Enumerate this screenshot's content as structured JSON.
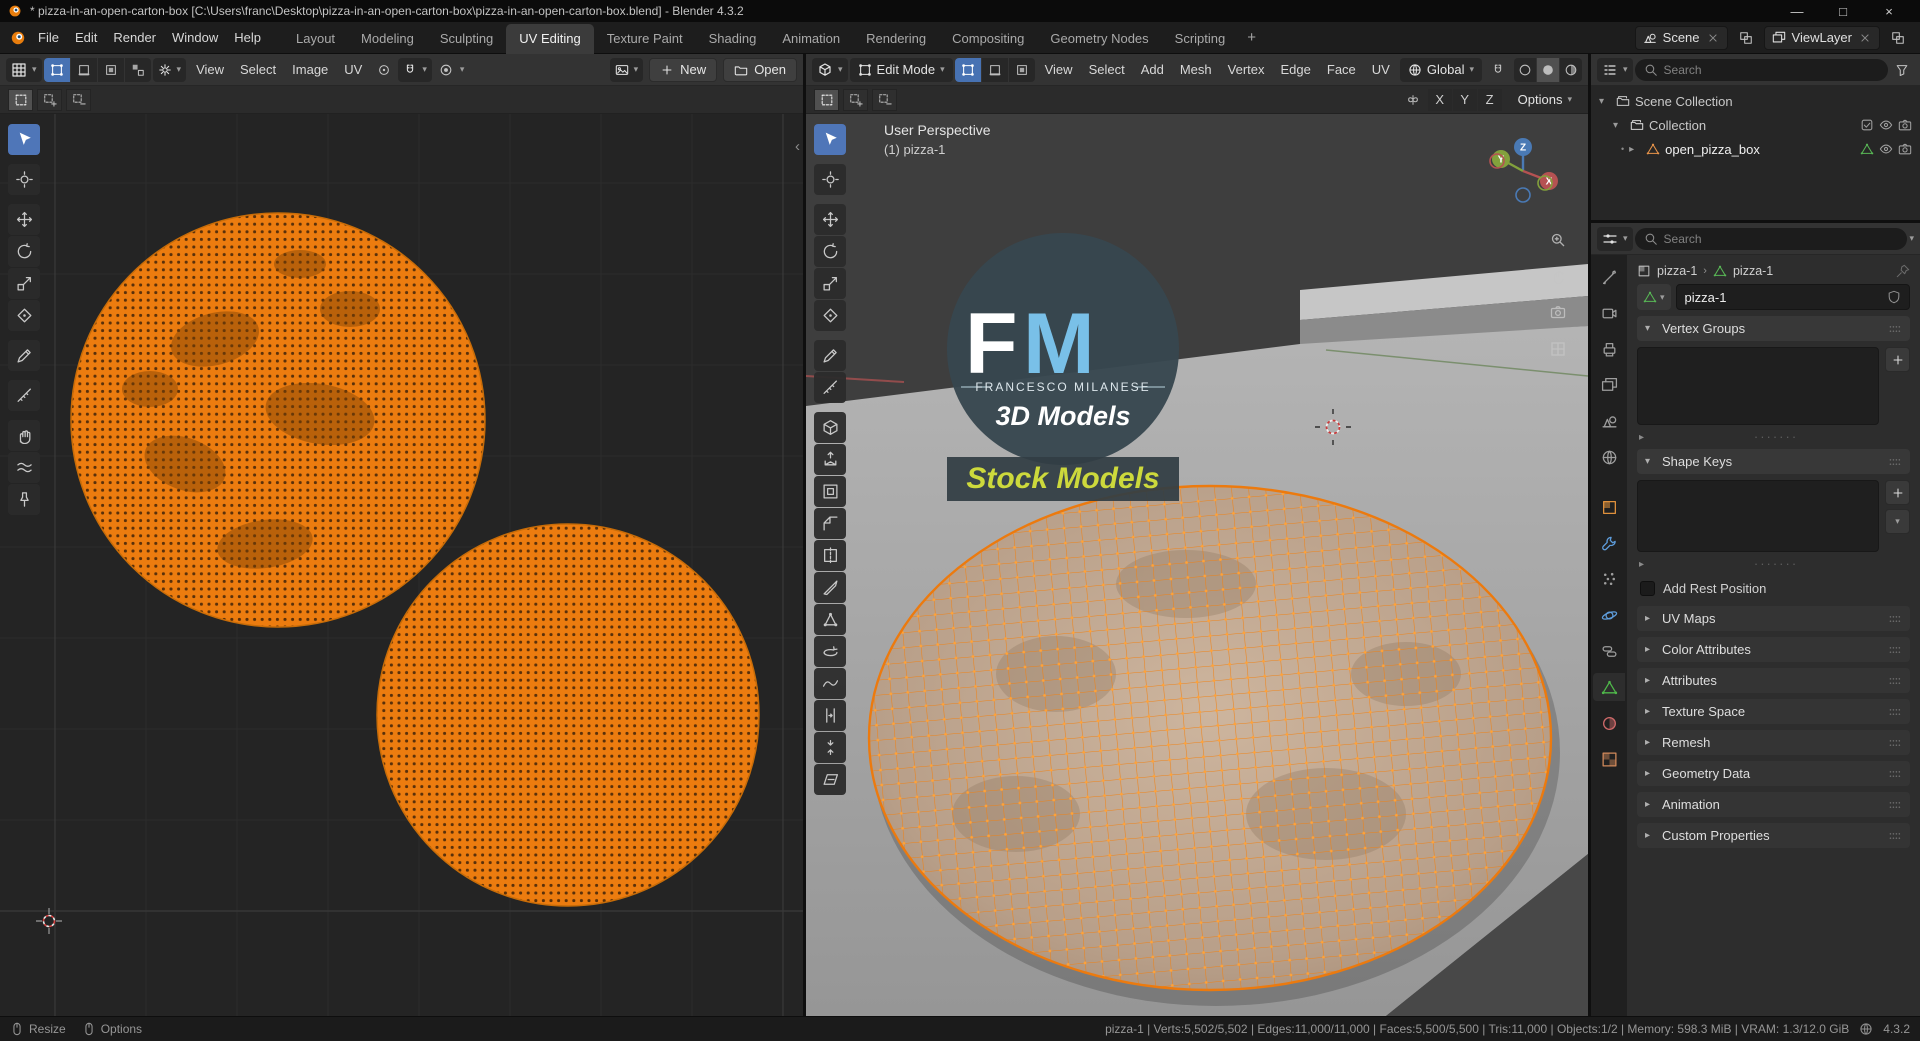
{
  "window": {
    "title": "* pizza-in-an-open-carton-box [C:\\Users\\franc\\Desktop\\pizza-in-an-open-carton-box\\pizza-in-an-open-carton-box.blend] - Blender 4.3.2",
    "minimize": "—",
    "maximize": "□",
    "close": "×"
  },
  "glyphs": {
    "expanded": "▾",
    "collapsed": "▸",
    "chevron": "▾",
    "bc_sep": "›",
    "region_collapse": "‹",
    "bullet": "•",
    "dots": "·······",
    "plus": "+",
    "minus": "−"
  },
  "topbar": {
    "menus": [
      "File",
      "Edit",
      "Render",
      "Window",
      "Help"
    ],
    "workspaces": [
      {
        "label": "Layout"
      },
      {
        "label": "Modeling"
      },
      {
        "label": "Sculpting"
      },
      {
        "label": "UV Editing",
        "active": true
      },
      {
        "label": "Texture Paint"
      },
      {
        "label": "Shading"
      },
      {
        "label": "Animation"
      },
      {
        "label": "Rendering"
      },
      {
        "label": "Compositing"
      },
      {
        "label": "Geometry Nodes"
      },
      {
        "label": "Scripting"
      }
    ],
    "add_workspace": "+",
    "scene": "Scene",
    "view_layer": "ViewLayer"
  },
  "uv_editor": {
    "menus": [
      "View",
      "Select",
      "Image",
      "UV"
    ],
    "new_button": "New",
    "open_button": "Open",
    "tools": [
      {
        "name": "select-box",
        "icon": "select",
        "active": true
      },
      {
        "name": "cursor",
        "icon": "cursor",
        "gap": true
      },
      {
        "name": "move",
        "icon": "move",
        "gap": true
      },
      {
        "name": "rotate",
        "icon": "rotate"
      },
      {
        "name": "scale",
        "icon": "scale"
      },
      {
        "name": "transform",
        "icon": "transform"
      },
      {
        "name": "annotate",
        "icon": "annotate",
        "gap": true
      },
      {
        "name": "measure",
        "icon": "measure",
        "gap": true
      },
      {
        "name": "grab",
        "icon": "grab",
        "gap": true
      },
      {
        "name": "relax",
        "icon": "relax"
      },
      {
        "name": "pin",
        "icon": "pin"
      }
    ]
  },
  "viewport": {
    "mode": "Edit Mode",
    "menus": [
      "View",
      "Select",
      "Add",
      "Mesh",
      "Vertex",
      "Edge",
      "Face",
      "UV"
    ],
    "orientation": "Global",
    "mirror": [
      "X",
      "Y",
      "Z"
    ],
    "options_label": "Options",
    "overlay_perspective": "User Perspective",
    "overlay_object": "(1) pizza-1",
    "axis_x": "X",
    "axis_y": "Y",
    "axis_z": "Z",
    "logo": {
      "f": "F",
      "m": "M",
      "name": "FRANCESCO MILANESE",
      "tagline": "3D Models",
      "badge": "Stock Models"
    },
    "tools": [
      {
        "name": "select-box",
        "icon": "select",
        "active": true
      },
      {
        "name": "cursor",
        "icon": "cursor",
        "gap": true
      },
      {
        "name": "move",
        "icon": "move",
        "gap": true
      },
      {
        "name": "rotate",
        "icon": "rotate"
      },
      {
        "name": "scale",
        "icon": "scale"
      },
      {
        "name": "transform",
        "icon": "transform"
      },
      {
        "name": "annotate",
        "icon": "annotate",
        "gap": true
      },
      {
        "name": "measure",
        "icon": "measure"
      },
      {
        "name": "add-cube",
        "icon": "cube",
        "gap": true
      },
      {
        "name": "extrude-region",
        "icon": "extrude"
      },
      {
        "name": "inset-faces",
        "icon": "inset"
      },
      {
        "name": "bevel",
        "icon": "bevel"
      },
      {
        "name": "loop-cut",
        "icon": "loopcut"
      },
      {
        "name": "knife",
        "icon": "knife"
      },
      {
        "name": "poly-build",
        "icon": "polybuild"
      },
      {
        "name": "spin",
        "icon": "spin"
      },
      {
        "name": "smooth",
        "icon": "smooth"
      },
      {
        "name": "edge-slide",
        "icon": "slide"
      },
      {
        "name": "shrink-fatten",
        "icon": "shrink"
      },
      {
        "name": "shear",
        "icon": "shear"
      }
    ]
  },
  "outliner": {
    "search_placeholder": "Search",
    "scene_collection": "Scene Collection",
    "collection": "Collection",
    "object": "open_pizza_box"
  },
  "properties": {
    "search_placeholder": "Search",
    "breadcrumb_object": "pizza-1",
    "breadcrumb_data": "pizza-1",
    "name_value": "pizza-1",
    "tabs": [
      {
        "name": "tool",
        "icon": "tool"
      },
      {
        "name": "render",
        "icon": "render"
      },
      {
        "name": "output",
        "icon": "printer"
      },
      {
        "name": "view-layer",
        "icon": "images"
      },
      {
        "name": "scene",
        "icon": "scene"
      },
      {
        "name": "world",
        "icon": "globe"
      },
      {
        "name": "object",
        "icon": "object",
        "gap": true,
        "color": "#e0913c"
      },
      {
        "name": "modifiers",
        "icon": "wrench",
        "color": "#5e9ddc"
      },
      {
        "name": "particles",
        "icon": "particles"
      },
      {
        "name": "physics",
        "icon": "physics",
        "color": "#5e9ddc"
      },
      {
        "name": "constraints",
        "icon": "constraint"
      },
      {
        "name": "data",
        "icon": "tri-mesh",
        "active": true,
        "color": "#4fb84a"
      },
      {
        "name": "material",
        "icon": "material",
        "color": "#d06a6a"
      },
      {
        "name": "texture",
        "icon": "texture",
        "color": "#d0895a"
      }
    ],
    "vertex_groups_label": "Vertex Groups",
    "shape_keys_label": "Shape Keys",
    "add_rest_position_label": "Add Rest Position",
    "collapsed_panels": [
      {
        "label": "UV Maps"
      },
      {
        "label": "Color Attributes"
      },
      {
        "label": "Attributes"
      },
      {
        "label": "Texture Space"
      },
      {
        "label": "Remesh"
      },
      {
        "label": "Geometry Data"
      },
      {
        "label": "Animation"
      },
      {
        "label": "Custom Properties"
      }
    ]
  },
  "status_bar": {
    "resize": "Resize",
    "options": "Options",
    "stats": "pizza-1  |  Verts:5,502/5,502 | Edges:11,000/11,000 | Faces:5,500/5,500 | Tris:11,000 | Objects:1/2 | Memory: 598.3 MiB | VRAM: 1.3/12.0 GiB",
    "version": "4.3.2"
  },
  "colors": {
    "accent": "#4772b3",
    "selection_orange": "#ec7c0f",
    "viewport_bg": "#3e3e3e"
  }
}
